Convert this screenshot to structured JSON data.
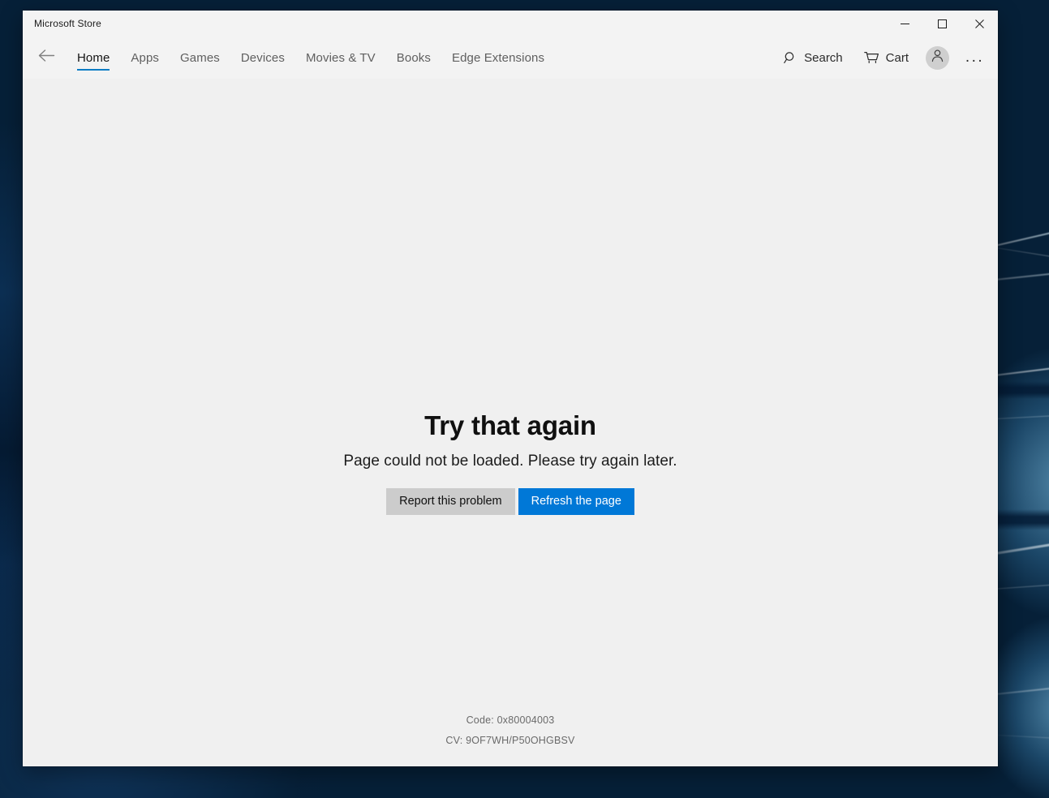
{
  "window": {
    "app_title": "Microsoft Store",
    "controls": {
      "minimize": "minimize",
      "maximize": "maximize",
      "close": "close"
    }
  },
  "nav": {
    "back_label": "Back",
    "tabs": [
      {
        "label": "Home",
        "active": true
      },
      {
        "label": "Apps",
        "active": false
      },
      {
        "label": "Games",
        "active": false
      },
      {
        "label": "Devices",
        "active": false
      },
      {
        "label": "Movies & TV",
        "active": false
      },
      {
        "label": "Books",
        "active": false
      },
      {
        "label": "Edge Extensions",
        "active": false
      }
    ],
    "actions": {
      "search_label": "Search",
      "cart_label": "Cart",
      "account_label": "Account",
      "more_label": "..."
    }
  },
  "error": {
    "title": "Try that again",
    "subtitle": "Page could not be loaded. Please try again later.",
    "report_button": "Report this problem",
    "refresh_button": "Refresh the page",
    "code_line": "Code: 0x80004003",
    "cv_line": "CV: 9OF7WH/P50OHGBSV"
  },
  "colors": {
    "accent": "#0078d7",
    "tab_underline": "#0a7cc4",
    "secondary_button": "#cccccc",
    "window_background": "#f0f0f0",
    "titlebar_background": "#f3f3f3",
    "code_text": "#6a6a6a"
  }
}
